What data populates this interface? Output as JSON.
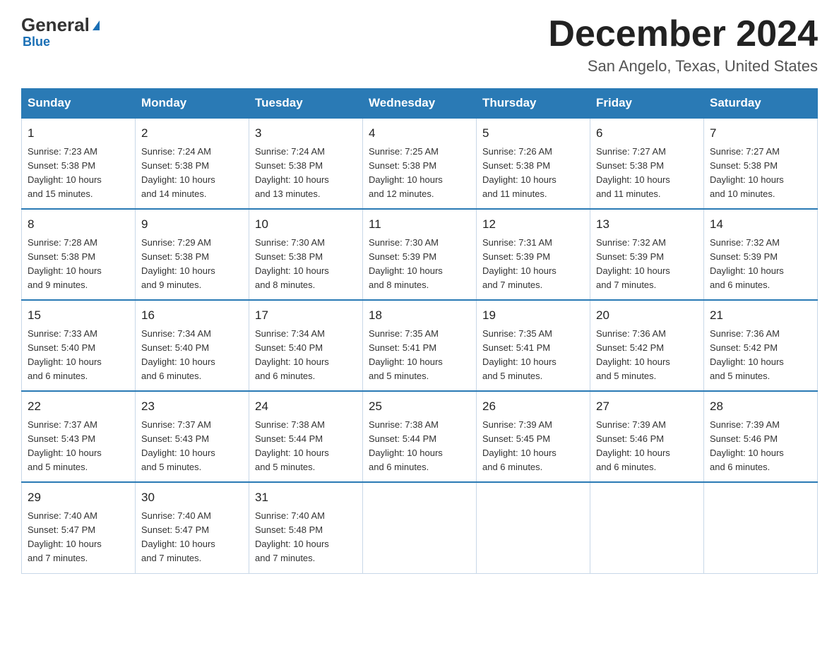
{
  "header": {
    "logo_general": "General",
    "logo_blue": "Blue",
    "month_title": "December 2024",
    "location": "San Angelo, Texas, United States"
  },
  "weekdays": [
    "Sunday",
    "Monday",
    "Tuesday",
    "Wednesday",
    "Thursday",
    "Friday",
    "Saturday"
  ],
  "weeks": [
    [
      {
        "day": "1",
        "sunrise": "7:23 AM",
        "sunset": "5:38 PM",
        "daylight": "10 hours and 15 minutes."
      },
      {
        "day": "2",
        "sunrise": "7:24 AM",
        "sunset": "5:38 PM",
        "daylight": "10 hours and 14 minutes."
      },
      {
        "day": "3",
        "sunrise": "7:24 AM",
        "sunset": "5:38 PM",
        "daylight": "10 hours and 13 minutes."
      },
      {
        "day": "4",
        "sunrise": "7:25 AM",
        "sunset": "5:38 PM",
        "daylight": "10 hours and 12 minutes."
      },
      {
        "day": "5",
        "sunrise": "7:26 AM",
        "sunset": "5:38 PM",
        "daylight": "10 hours and 11 minutes."
      },
      {
        "day": "6",
        "sunrise": "7:27 AM",
        "sunset": "5:38 PM",
        "daylight": "10 hours and 11 minutes."
      },
      {
        "day": "7",
        "sunrise": "7:27 AM",
        "sunset": "5:38 PM",
        "daylight": "10 hours and 10 minutes."
      }
    ],
    [
      {
        "day": "8",
        "sunrise": "7:28 AM",
        "sunset": "5:38 PM",
        "daylight": "10 hours and 9 minutes."
      },
      {
        "day": "9",
        "sunrise": "7:29 AM",
        "sunset": "5:38 PM",
        "daylight": "10 hours and 9 minutes."
      },
      {
        "day": "10",
        "sunrise": "7:30 AM",
        "sunset": "5:38 PM",
        "daylight": "10 hours and 8 minutes."
      },
      {
        "day": "11",
        "sunrise": "7:30 AM",
        "sunset": "5:39 PM",
        "daylight": "10 hours and 8 minutes."
      },
      {
        "day": "12",
        "sunrise": "7:31 AM",
        "sunset": "5:39 PM",
        "daylight": "10 hours and 7 minutes."
      },
      {
        "day": "13",
        "sunrise": "7:32 AM",
        "sunset": "5:39 PM",
        "daylight": "10 hours and 7 minutes."
      },
      {
        "day": "14",
        "sunrise": "7:32 AM",
        "sunset": "5:39 PM",
        "daylight": "10 hours and 6 minutes."
      }
    ],
    [
      {
        "day": "15",
        "sunrise": "7:33 AM",
        "sunset": "5:40 PM",
        "daylight": "10 hours and 6 minutes."
      },
      {
        "day": "16",
        "sunrise": "7:34 AM",
        "sunset": "5:40 PM",
        "daylight": "10 hours and 6 minutes."
      },
      {
        "day": "17",
        "sunrise": "7:34 AM",
        "sunset": "5:40 PM",
        "daylight": "10 hours and 6 minutes."
      },
      {
        "day": "18",
        "sunrise": "7:35 AM",
        "sunset": "5:41 PM",
        "daylight": "10 hours and 5 minutes."
      },
      {
        "day": "19",
        "sunrise": "7:35 AM",
        "sunset": "5:41 PM",
        "daylight": "10 hours and 5 minutes."
      },
      {
        "day": "20",
        "sunrise": "7:36 AM",
        "sunset": "5:42 PM",
        "daylight": "10 hours and 5 minutes."
      },
      {
        "day": "21",
        "sunrise": "7:36 AM",
        "sunset": "5:42 PM",
        "daylight": "10 hours and 5 minutes."
      }
    ],
    [
      {
        "day": "22",
        "sunrise": "7:37 AM",
        "sunset": "5:43 PM",
        "daylight": "10 hours and 5 minutes."
      },
      {
        "day": "23",
        "sunrise": "7:37 AM",
        "sunset": "5:43 PM",
        "daylight": "10 hours and 5 minutes."
      },
      {
        "day": "24",
        "sunrise": "7:38 AM",
        "sunset": "5:44 PM",
        "daylight": "10 hours and 5 minutes."
      },
      {
        "day": "25",
        "sunrise": "7:38 AM",
        "sunset": "5:44 PM",
        "daylight": "10 hours and 6 minutes."
      },
      {
        "day": "26",
        "sunrise": "7:39 AM",
        "sunset": "5:45 PM",
        "daylight": "10 hours and 6 minutes."
      },
      {
        "day": "27",
        "sunrise": "7:39 AM",
        "sunset": "5:46 PM",
        "daylight": "10 hours and 6 minutes."
      },
      {
        "day": "28",
        "sunrise": "7:39 AM",
        "sunset": "5:46 PM",
        "daylight": "10 hours and 6 minutes."
      }
    ],
    [
      {
        "day": "29",
        "sunrise": "7:40 AM",
        "sunset": "5:47 PM",
        "daylight": "10 hours and 7 minutes."
      },
      {
        "day": "30",
        "sunrise": "7:40 AM",
        "sunset": "5:47 PM",
        "daylight": "10 hours and 7 minutes."
      },
      {
        "day": "31",
        "sunrise": "7:40 AM",
        "sunset": "5:48 PM",
        "daylight": "10 hours and 7 minutes."
      },
      null,
      null,
      null,
      null
    ]
  ],
  "labels": {
    "sunrise": "Sunrise:",
    "sunset": "Sunset:",
    "daylight": "Daylight:"
  }
}
